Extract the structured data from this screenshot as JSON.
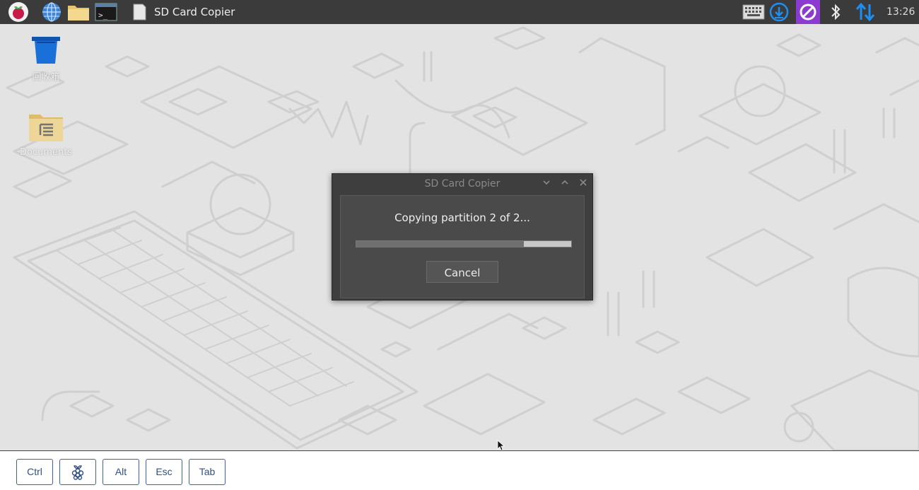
{
  "taskbar": {
    "icons": {
      "menu": "raspberry-icon",
      "browser": "globe-icon",
      "files": "folder-icon",
      "terminal": "terminal-icon",
      "app": "sd-card-icon",
      "keyboard": "keyboard-icon",
      "updates": "download-icon",
      "vnc": "vnc-icon",
      "bluetooth": "bluetooth-icon",
      "network": "network-arrows-icon"
    },
    "active_task": "SD Card Copier",
    "clock": "13:26",
    "colors": {
      "bar": "#3b3b3b",
      "accent": "#1e8ef3",
      "vnc": "#8c3bd1"
    }
  },
  "desktop": {
    "icons": [
      {
        "name": "trash",
        "label": "回收箱"
      },
      {
        "name": "documents",
        "label": "Documents"
      }
    ]
  },
  "dialog": {
    "title": "SD Card Copier",
    "message": "Copying partition 2 of 2...",
    "progress": 0.78,
    "cancel_label": "Cancel"
  },
  "keyboard_bar": {
    "keys": [
      "Ctrl",
      "",
      "Alt",
      "Esc",
      "Tab"
    ],
    "key_color": "#3a63a8"
  }
}
